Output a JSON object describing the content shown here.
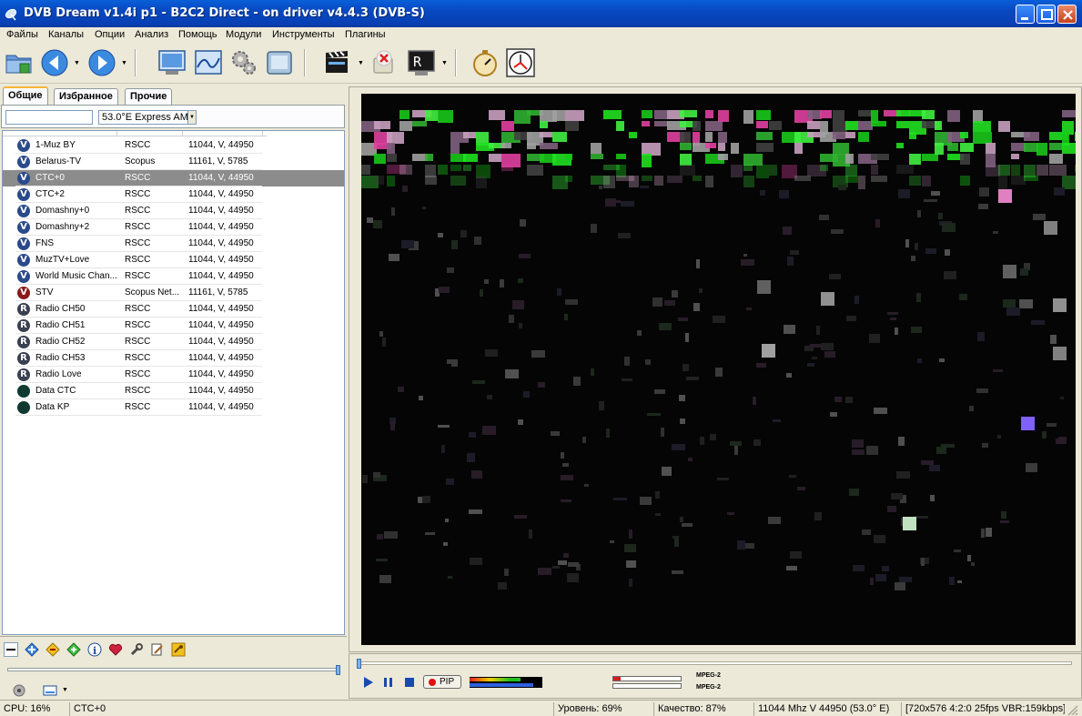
{
  "window": {
    "title": "DVB Dream v1.4i p1 - B2C2 Direct - on driver v4.4.3 (DVB-S)"
  },
  "menu": [
    "Файлы",
    "Каналы",
    "Опции",
    "Анализ",
    "Помощь",
    "Модули",
    "Инструменты",
    "Плагины"
  ],
  "toolbar": {
    "icons": [
      "open-folder-icon",
      "back-icon",
      "forward-icon",
      "monitor-icon",
      "spectrum-icon",
      "settings-gears-icon",
      "screen-icon",
      "clapper-icon",
      "stop-record-icon",
      "record-terminal-icon",
      "stopwatch-icon",
      "scheduler-clock-icon"
    ]
  },
  "tabs": [
    "Общие",
    "Избранное",
    "Прочие"
  ],
  "filter": {
    "search_value": "",
    "satellite": "53.0°E Express AM"
  },
  "channels": [
    {
      "type": "V",
      "name": "1-Muz BY",
      "provider": "RSCC",
      "freq": "11044, V, 44950",
      "color": "#2a4a8a"
    },
    {
      "type": "V",
      "name": "Belarus-TV",
      "provider": "Scopus",
      "freq": "11161, V, 5785",
      "color": "#2a4a8a"
    },
    {
      "type": "V",
      "name": "CTC+0",
      "provider": "RSCC",
      "freq": "11044, V, 44950",
      "color": "#2a4a8a",
      "selected": true
    },
    {
      "type": "V",
      "name": "CTC+2",
      "provider": "RSCC",
      "freq": "11044, V, 44950",
      "color": "#2a4a8a"
    },
    {
      "type": "V",
      "name": "Domashny+0",
      "provider": "RSCC",
      "freq": "11044, V, 44950",
      "color": "#2a4a8a"
    },
    {
      "type": "V",
      "name": "Domashny+2",
      "provider": "RSCC",
      "freq": "11044, V, 44950",
      "color": "#2a4a8a"
    },
    {
      "type": "V",
      "name": "FNS",
      "provider": "RSCC",
      "freq": "11044, V, 44950",
      "color": "#2a4a8a"
    },
    {
      "type": "V",
      "name": "MuzTV+Love",
      "provider": "RSCC",
      "freq": "11044, V, 44950",
      "color": "#2a4a8a"
    },
    {
      "type": "V",
      "name": "World Music Chan...",
      "provider": "RSCC",
      "freq": "11044, V, 44950",
      "color": "#2a4a8a"
    },
    {
      "type": "V",
      "name": "STV",
      "provider": "Scopus Net...",
      "freq": "11161, V, 5785",
      "color": "#8a1a1a"
    },
    {
      "type": "R",
      "name": "Radio CH50",
      "provider": "RSCC",
      "freq": "11044, V, 44950",
      "color": "#3a4050"
    },
    {
      "type": "R",
      "name": "Radio CH51",
      "provider": "RSCC",
      "freq": "11044, V, 44950",
      "color": "#3a4050"
    },
    {
      "type": "R",
      "name": "Radio CH52",
      "provider": "RSCC",
      "freq": "11044, V, 44950",
      "color": "#3a4050"
    },
    {
      "type": "R",
      "name": "Radio CH53",
      "provider": "RSCC",
      "freq": "11044, V, 44950",
      "color": "#3a4050"
    },
    {
      "type": "R",
      "name": "Radio Love",
      "provider": "RSCC",
      "freq": "11044, V, 44950",
      "color": "#3a4050"
    },
    {
      "type": "D",
      "name": "Data CTC",
      "provider": "RSCC",
      "freq": "11044, V, 44950",
      "color": "#103a30"
    },
    {
      "type": "D",
      "name": "Data KP",
      "provider": "RSCC",
      "freq": "11044, V, 44950",
      "color": "#103a30"
    }
  ],
  "playback": {
    "pip_label": "PIP",
    "signal_level": 0.69,
    "quality_level": 0.87,
    "video_codec": "MPEG-2",
    "audio_codec": "MPEG-2"
  },
  "status": {
    "cpu": "CPU: 16%",
    "channel": "CTC+0",
    "level": "Уровень: 69%",
    "quality": "Качество: 87%",
    "tuning": "11044 Mhz  V  44950  (53.0° E)",
    "stream": "[720x576 4:2:0 25fps  VBR:159kbps]"
  }
}
